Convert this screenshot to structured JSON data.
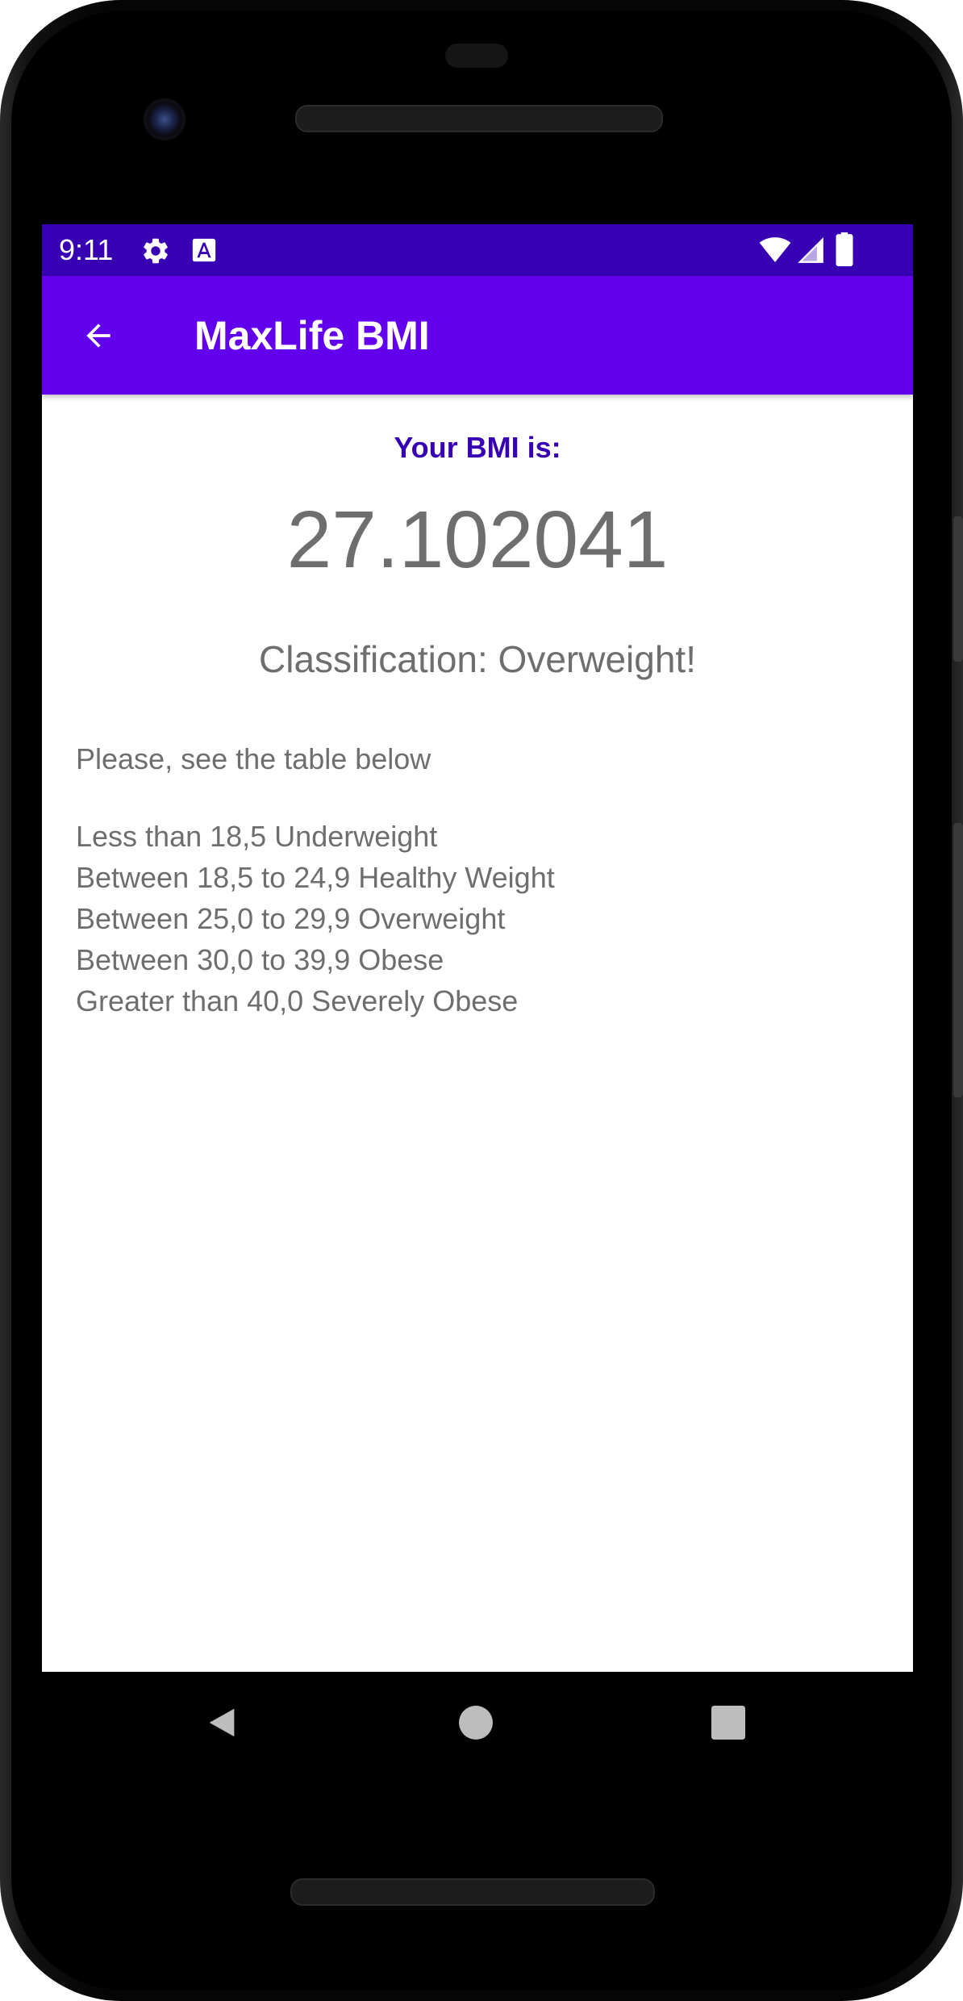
{
  "status_bar": {
    "time": "9:11",
    "icons": [
      "settings-icon",
      "font-download-icon",
      "wifi-icon",
      "signal-icon",
      "battery-icon"
    ],
    "color": "#3700b3"
  },
  "app_bar": {
    "title": "MaxLife BMI",
    "back_icon": "arrow-back-icon",
    "color": "#6200ee"
  },
  "result": {
    "heading": "Your BMI is:",
    "value": "27.102041",
    "classification": "Classification: Overweight!",
    "heading_color": "#3700b3"
  },
  "table": {
    "intro": "Please, see the table below",
    "rows": [
      "Less than 18,5 Underweight",
      "Between 18,5 to 24,9 Healthy Weight",
      "Between 25,0 to 29,9 Overweight",
      "Between 30,0 to 39,9 Obese",
      "Greater than 40,0 Severely Obese"
    ]
  },
  "nav_bar": {
    "back": "back-triangle-icon",
    "home": "home-circle-icon",
    "recents": "recents-square-icon"
  }
}
